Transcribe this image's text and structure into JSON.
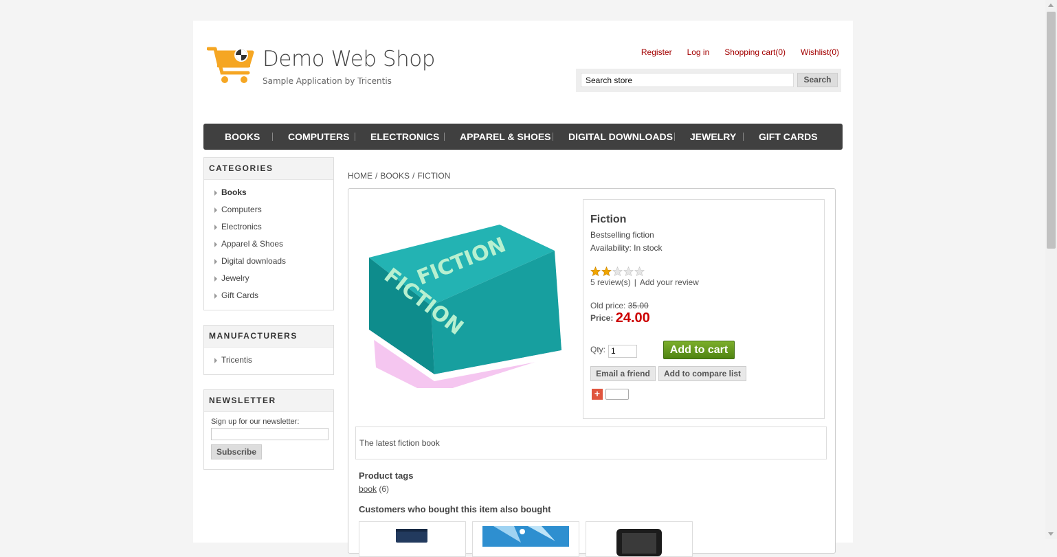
{
  "header": {
    "title": "Demo Web Shop",
    "subtitle": "Sample Application by Tricentis",
    "links": {
      "register": "Register",
      "login": "Log in",
      "cart": "Shopping cart(0)",
      "wishlist": "Wishlist(0)"
    },
    "search_value": "Search store",
    "search_button": "Search"
  },
  "menu": [
    "BOOKS",
    "COMPUTERS",
    "ELECTRONICS",
    "APPAREL & SHOES",
    "DIGITAL DOWNLOADS",
    "JEWELRY",
    "GIFT CARDS"
  ],
  "sidebar": {
    "categories_title": "CATEGORIES",
    "categories": [
      "Books",
      "Computers",
      "Electronics",
      "Apparel & Shoes",
      "Digital downloads",
      "Jewelry",
      "Gift Cards"
    ],
    "manufacturers_title": "MANUFACTURERS",
    "manufacturers": [
      "Tricentis"
    ],
    "newsletter_title": "NEWSLETTER",
    "newsletter_label": "Sign up for our newsletter:",
    "newsletter_button": "Subscribe"
  },
  "breadcrumb": [
    "HOME",
    "BOOKS",
    "FICTION"
  ],
  "product": {
    "name": "Fiction",
    "short_description": "Bestselling fiction",
    "availability": "Availability: In stock",
    "rating": 2,
    "rating_max": 5,
    "reviews": "5 review(s)",
    "add_review": "Add your review",
    "old_price_label": "Old price:",
    "old_price": "35.00",
    "price_label": "Price:",
    "price": "24.00",
    "qty_label": "Qty:",
    "qty": "1",
    "add_to_cart": "Add to cart",
    "email_friend": "Email a friend",
    "compare": "Add to compare list",
    "image_text": "FICTION",
    "full_description": "The latest fiction book",
    "tags_title": "Product tags",
    "tag_name": "book",
    "tag_count": "(6)",
    "also_bought_title": "Customers who bought this item also bought"
  },
  "colors": {
    "link_red": "#a30000",
    "menu_bg": "#404040",
    "price_red": "#cc0000",
    "cart_green": "#5f9618",
    "book_teal": "#1a9e9e"
  },
  "icons": {
    "logo": "shopping-cart-icon",
    "star": "star-icon",
    "share": "plus-share-icon",
    "bullet": "triangle-right-icon"
  }
}
